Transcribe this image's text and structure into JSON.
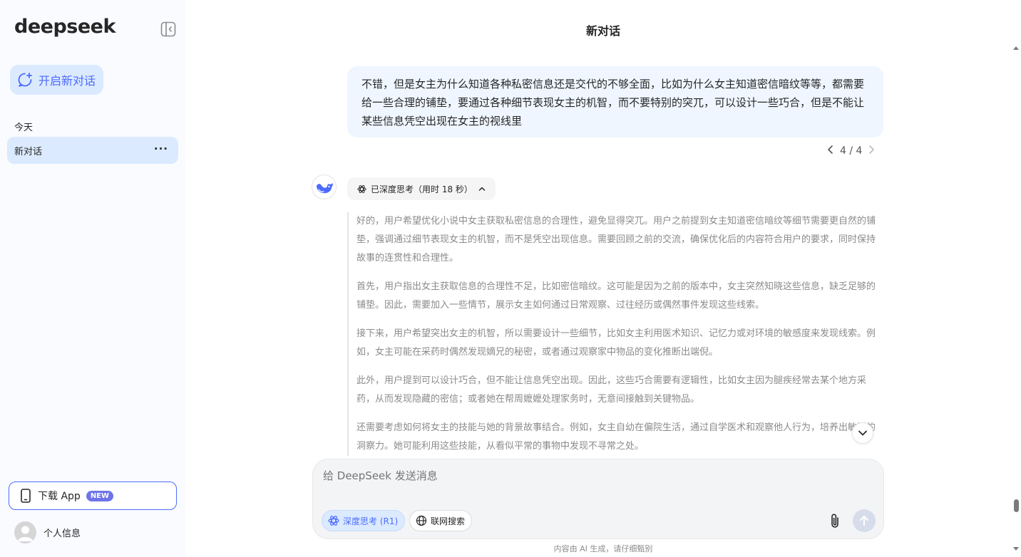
{
  "sidebar": {
    "logo": "deepseek",
    "new_chat_label": "开启新对话",
    "section_today": "今天",
    "conversations": [
      {
        "label": "新对话",
        "more": "···"
      }
    ],
    "download_label": "下载 App",
    "download_badge": "NEW",
    "profile_label": "个人信息"
  },
  "header": {
    "title": "新对话"
  },
  "chat": {
    "user_message": "不错，但是女主为什么知道各种私密信息还是交代的不够全面，比如为什么女主知道密信暗纹等等，都需要给一些合理的铺垫，要通过各种细节表现女主的机智，而不要特别的突兀，可以设计一些巧合，但是不能让某些信息凭空出现在女主的视线里",
    "pager": "4 / 4",
    "thinking_chip": "已深度思考（用时 18 秒）",
    "thinking_paragraphs": [
      "好的，用户希望优化小说中女主获取私密信息的合理性，避免显得突兀。用户之前提到女主知道密信暗纹等细节需要更自然的铺垫，强调通过细节表现女主的机智，而不是凭空出现信息。需要回顾之前的交流，确保优化后的内容符合用户的要求，同时保持故事的连贯性和合理性。",
      "首先，用户指出女主获取信息的合理性不足，比如密信暗纹。这可能是因为之前的版本中，女主突然知晓这些信息，缺乏足够的铺垫。因此，需要加入一些情节，展示女主如何通过日常观察、过往经历或偶然事件发现这些线索。",
      "接下来，用户希望突出女主的机智，所以需要设计一些细节，比如女主利用医术知识、记忆力或对环境的敏感度来发现线索。例如，女主可能在采药时偶然发现嫡兄的秘密，或者通过观察家中物品的变化推断出端倪。",
      "此外，用户提到可以设计巧合，但不能让信息凭空出现。因此，这些巧合需要有逻辑性，比如女主因为腿疾经常去某个地方采药，从而发现隐藏的密信；或者她在帮周嬷嬷处理家务时，无意间接触到关键物品。",
      "还需要考虑如何将女主的技能与她的背景故事结合。例如，女主自幼在偏院生活，通过自学医术和观察他人行为，培养出敏锐的洞察力。她可能利用这些技能，从看似平常的事物中发现不寻常之处。"
    ]
  },
  "composer": {
    "placeholder": "给 DeepSeek 发送消息",
    "deep_think_label": "深度思考 (R1)",
    "web_search_label": "联网搜索"
  },
  "footer": {
    "disclaimer": "内容由 AI 生成，请仔细甄别"
  },
  "colors": {
    "accent": "#4d6bfe",
    "sidebar_bg": "#f9fbff",
    "selected_bg": "#dbeafe",
    "user_bubble_bg": "#eff6ff"
  }
}
